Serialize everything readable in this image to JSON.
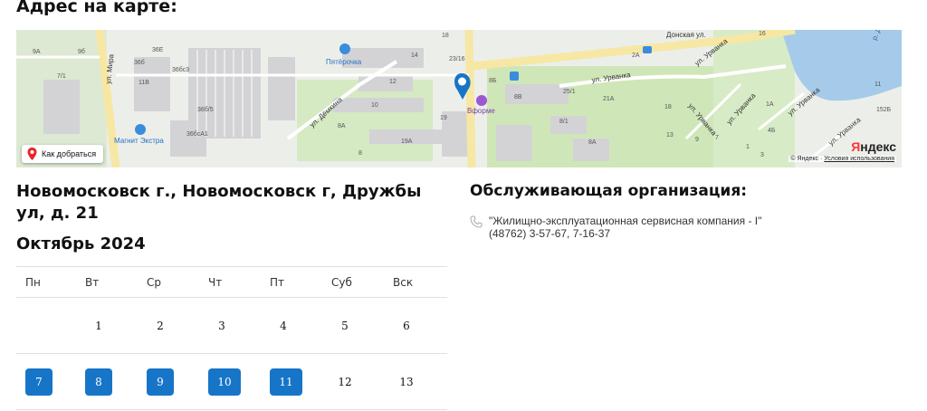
{
  "page": {
    "map_heading": "Адрес на карте:",
    "address": "Новомосковск г., Новомосковск г, Дружбы ул, д. 21",
    "month": "Октябрь 2024"
  },
  "map": {
    "route_button": "Как добраться",
    "logo": "Яндекс",
    "copyright": "© Яндекс",
    "terms_link": "Условия использования",
    "labels": {
      "street_mira": "ул. Мира",
      "street_demkina": "ул. Дёмкина",
      "street_donskaya": "Донская ул.",
      "street_urvanka_1": "ул. Урванка",
      "street_urvanka_2": "ул. Урванка",
      "street_urvanka_3": "ул. Урванка",
      "street_urvanka_4": "ул. Урванка",
      "street_urvanka_5": "ул. Урванка",
      "street_urvanka_6": "ул. Урванка",
      "poi_pyaterochka": "Пятёрочка",
      "poi_magnit": "Магнит Экстра",
      "poi_vforme": "Вформе",
      "h_9a": "9А",
      "h_9b": "9б",
      "h_7_1": "7/1",
      "h_36e": "36Е",
      "h_36b": "36б",
      "h_36bc3": "36бс3",
      "h_11b": "11В",
      "h_36b5": "36б/5",
      "h_36bc1": "36бсА1",
      "h_18": "18",
      "h_14": "14",
      "h_23_16": "23/16",
      "h_12": "12",
      "h_10": "10",
      "h_8a": "8А",
      "h_19": "19",
      "h_19a": "19А",
      "h_8": "8",
      "h_8b": "8Б",
      "h_8v": "8В",
      "h_25_1": "25/1",
      "h_21a": "21А",
      "h_8_1": "8/1",
      "h_8a2": "8А",
      "h_2a": "2А",
      "h_16": "16",
      "h_11": "11",
      "h_152b": "152Б",
      "h_1a": "1А",
      "h_4b": "4Б",
      "h_18r": "18",
      "h_13": "13",
      "h_7": "7",
      "h_9": "9",
      "h_1": "1",
      "h_3": "3",
      "river": "р. Д"
    }
  },
  "calendar": {
    "weekdays": [
      "Пн",
      "Вт",
      "Ср",
      "Чт",
      "Пт",
      "Суб",
      "Вск"
    ],
    "weeks": [
      [
        {
          "day": "",
          "work": false
        },
        {
          "day": "1",
          "work": false
        },
        {
          "day": "2",
          "work": false
        },
        {
          "day": "3",
          "work": false
        },
        {
          "day": "4",
          "work": false
        },
        {
          "day": "5",
          "work": false
        },
        {
          "day": "6",
          "work": false
        }
      ],
      [
        {
          "day": "7",
          "work": true
        },
        {
          "day": "8",
          "work": true
        },
        {
          "day": "9",
          "work": true
        },
        {
          "day": "10",
          "work": true
        },
        {
          "day": "11",
          "work": true
        },
        {
          "day": "12",
          "work": false
        },
        {
          "day": "13",
          "work": false
        }
      ]
    ]
  },
  "org": {
    "title": "Обслуживающая организация:",
    "name": "\"Жилищно-эксплуатационная сервисная компания - I\"",
    "phones": "(48762) 3-57-67, 7-16-37",
    "icon": "phone-icon"
  },
  "colors": {
    "accent": "#1775c8",
    "map_water": "#a6cbea",
    "map_park": "#cfe7b8",
    "map_road": "#f7e7a4"
  }
}
